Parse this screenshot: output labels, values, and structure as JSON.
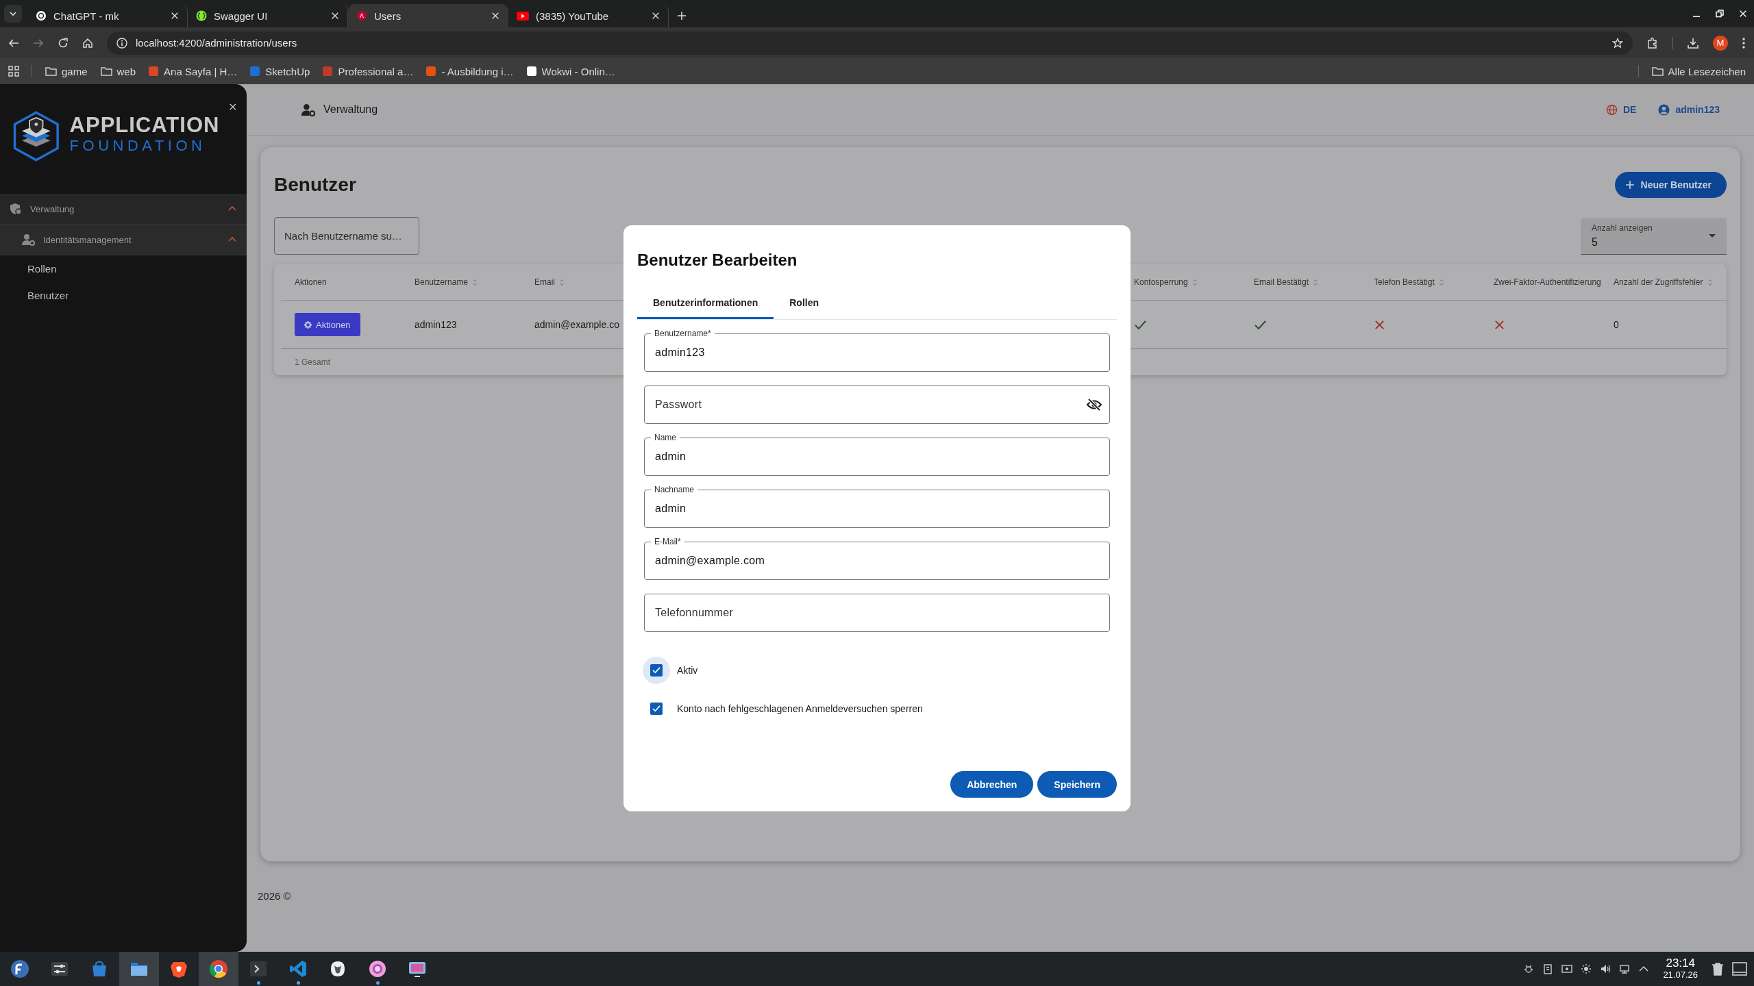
{
  "browser": {
    "tabs": [
      {
        "kind": "chatgpt",
        "title": "ChatGPT - mk",
        "selected": false
      },
      {
        "kind": "swagger",
        "title": "Swagger UI",
        "selected": false
      },
      {
        "kind": "angular",
        "title": "Users",
        "selected": true
      },
      {
        "kind": "youtube",
        "title": "(3835) YouTube",
        "selected": false
      }
    ],
    "url": "localhost:4200/administration/users",
    "profile_initial": "M",
    "bookmarks": [
      {
        "kind": "folder",
        "label": "game"
      },
      {
        "kind": "folder",
        "label": "web"
      },
      {
        "kind": "site",
        "label": "Ana Sayfa | H…",
        "color": "#d9472b"
      },
      {
        "kind": "site",
        "label": "SketchUp",
        "color": "#1e6fd0"
      },
      {
        "kind": "site",
        "label": "Professional a…",
        "color": "#c0392b"
      },
      {
        "kind": "site",
        "label": "- Ausbildung i…",
        "color": "#e8500f"
      },
      {
        "kind": "site",
        "label": "Wokwi - Onlin…",
        "color": "#ffffff"
      }
    ],
    "all_bookmarks": "Alle Lesezeichen"
  },
  "app": {
    "sidebar": {
      "brand_line1": "APPLICATION",
      "brand_line2": "FOUNDATION",
      "menu": [
        {
          "label": "Verwaltung",
          "expanded": true,
          "children": [
            {
              "label": "Identitätsmanagement",
              "expanded": true,
              "children": [
                {
                  "label": "Rollen"
                },
                {
                  "label": "Benutzer"
                }
              ]
            }
          ]
        }
      ]
    },
    "header": {
      "section": "Verwaltung",
      "language": "DE",
      "user": "admin123"
    },
    "page": {
      "title": "Benutzer",
      "new_button": "Neuer Benutzer",
      "search": {
        "placeholder": "Nach Benutzername su…"
      },
      "page_size": {
        "label": "Anzahl anzeigen",
        "value": "5"
      },
      "table": {
        "columns": [
          {
            "label": "Aktionen",
            "sortable": false
          },
          {
            "label": "Benutzername",
            "sortable": true
          },
          {
            "label": "Email",
            "sortable": true
          },
          {
            "label": "Kontosperrung",
            "sortable": true
          },
          {
            "label": "Email Bestätigt",
            "sortable": true
          },
          {
            "label": "Telefon Bestätigt",
            "sortable": true
          },
          {
            "label": "Zwei-Faktor-Authentifizierung",
            "sortable": false
          },
          {
            "label": "Anzahl der Zugriffsfehler",
            "sortable": true
          }
        ],
        "rows": [
          {
            "cells": [
              {
                "kind": "button",
                "text": "Aktionen"
              },
              {
                "kind": "text",
                "text": "admin123"
              },
              {
                "kind": "text",
                "text": "admin@example.co"
              },
              {
                "kind": "bool",
                "value": true
              },
              {
                "kind": "bool",
                "value": true
              },
              {
                "kind": "bool",
                "value": false
              },
              {
                "kind": "bool",
                "value": false
              },
              {
                "kind": "text",
                "text": "0"
              }
            ]
          }
        ],
        "total": "1 Gesamt"
      }
    },
    "footer": "2026 ©"
  },
  "dialog": {
    "title": "Benutzer Bearbeiten",
    "tabs": [
      {
        "label": "Benutzerinformationen",
        "selected": true
      },
      {
        "label": "Rollen",
        "selected": false
      }
    ],
    "fields": [
      {
        "kind": "text",
        "label": "Benutzername*",
        "value": "admin123"
      },
      {
        "kind": "password",
        "placeholder": "Passwort"
      },
      {
        "kind": "text",
        "label": "Name",
        "value": "admin"
      },
      {
        "kind": "text",
        "label": "Nachname",
        "value": "admin"
      },
      {
        "kind": "text",
        "label": "E-Mail*",
        "value": "admin@example.com"
      },
      {
        "kind": "text",
        "placeholder": "Telefonnummer"
      }
    ],
    "checkboxes": [
      {
        "label": "Aktiv",
        "checked": true,
        "focused": true
      },
      {
        "label": "Konto nach fehlgeschlagenen Anmeldeversuchen sperren",
        "checked": true,
        "focused": false
      }
    ],
    "buttons": [
      "Abbrechen",
      "Speichern"
    ]
  },
  "taskbar": {
    "apps": [
      {
        "kind": "fedora",
        "running": false,
        "highlighted": false
      },
      {
        "kind": "settings",
        "running": false,
        "highlighted": false
      },
      {
        "kind": "store",
        "running": false,
        "highlighted": false
      },
      {
        "kind": "files",
        "running": false,
        "highlighted": true
      },
      {
        "kind": "brave",
        "running": false,
        "highlighted": false
      },
      {
        "kind": "chrome",
        "running": false,
        "highlighted": true
      },
      {
        "kind": "terminal",
        "running": true,
        "highlighted": false
      },
      {
        "kind": "vscode",
        "running": true,
        "highlighted": false
      },
      {
        "kind": "creature",
        "running": false,
        "highlighted": false
      },
      {
        "kind": "pink",
        "running": true,
        "highlighted": false
      },
      {
        "kind": "monitor",
        "running": false,
        "highlighted": false
      }
    ],
    "time": "23:14",
    "date": "21.07.26"
  }
}
